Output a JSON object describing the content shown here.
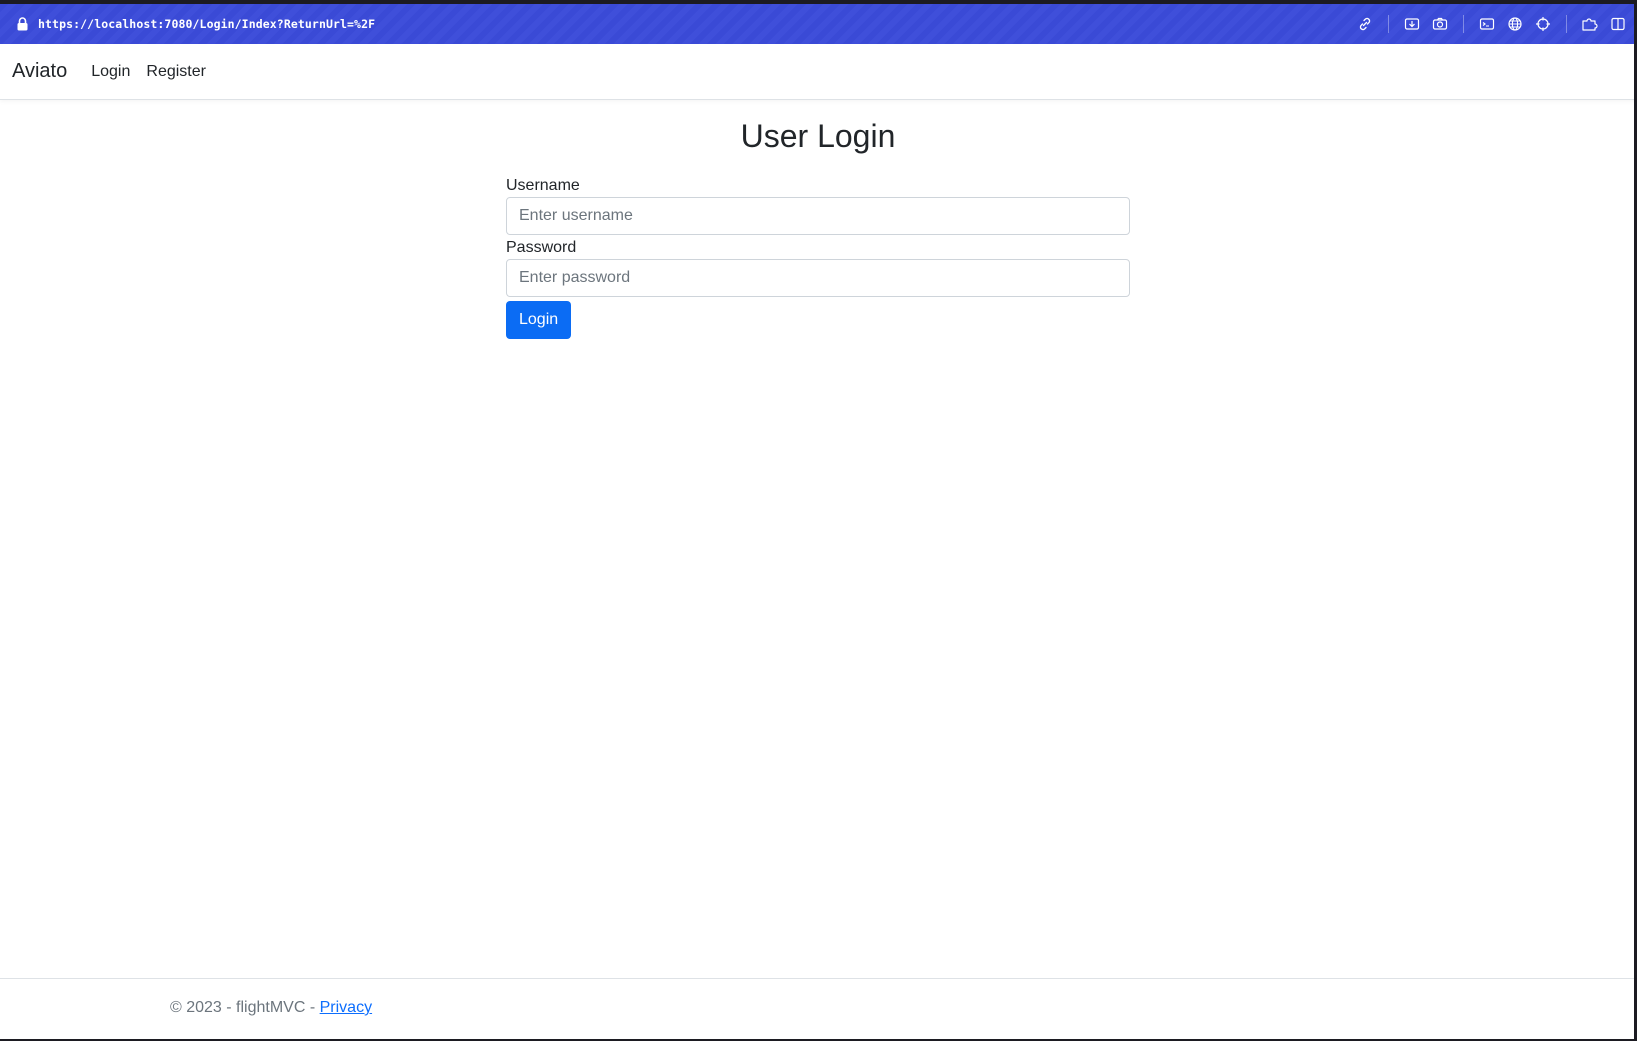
{
  "browser": {
    "url": "https://localhost:7080/Login/Index?ReturnUrl=%2F",
    "toolbar_icons": [
      "link-icon",
      "download-icon",
      "camera-icon",
      "terminal-icon",
      "globe-icon",
      "crosshair-icon",
      "extensions-icon",
      "sidebar-icon"
    ]
  },
  "navbar": {
    "brand": "Aviato",
    "links": [
      {
        "label": "Login"
      },
      {
        "label": "Register"
      }
    ]
  },
  "main": {
    "title": "User Login",
    "username_label": "Username",
    "username_placeholder": "Enter username",
    "username_value": "",
    "password_label": "Password",
    "password_placeholder": "Enter password",
    "password_value": "",
    "submit_label": "Login"
  },
  "footer": {
    "text": "© 2023 - flightMVC - ",
    "privacy_label": "Privacy"
  },
  "colors": {
    "urlbar_bg": "#3a4ad6",
    "primary": "#0b6cf4",
    "text": "#212529",
    "muted": "#6c757d"
  }
}
